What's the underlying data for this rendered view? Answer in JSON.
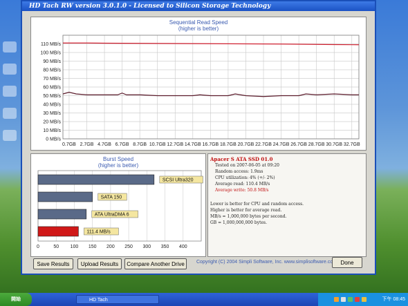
{
  "window": {
    "title": "HD Tach RW version 3.0.1.0 - Licensed to Silicon Storage Technology"
  },
  "read_chart": {
    "title": "Sequential Read Speed",
    "subtitle": "(higher is better)"
  },
  "burst_chart": {
    "title": "Burst Speed",
    "subtitle": "(higher is better)"
  },
  "results": {
    "drive_name": "Apacer S ATA SSD 01.0",
    "lines": [
      "Tested on 2007-06-05 at 09:20",
      "Random access: 1.9ms",
      "CPU utilization: 4% (+/- 2%)",
      "Average read: 110.4 MB/s",
      "Average write: 50.8 MB/s"
    ],
    "notes": [
      "Lower is better for CPU and random access.",
      "Higher is better for average read.",
      "MB/s = 1,000,000 bytes per second.",
      "GB = 1,000,000,000 bytes."
    ]
  },
  "buttons": {
    "save": "Save Results",
    "upload": "Upload Results",
    "compare": "Compare Another Drive",
    "done": "Done"
  },
  "copyright": "Copyright (C) 2004 Simpli Software, Inc. www.simplisoftware.com",
  "taskbar": {
    "start": "開始",
    "app": "HD Tach",
    "clock": "下午 08:45"
  },
  "colors": {
    "read_line": "#d02030",
    "write_line": "#5a1a2a",
    "burst_bar": "#5a6a88",
    "burst_bar_highlight": "#d01818",
    "label_box": "#f4e6a0"
  },
  "chart_data": [
    {
      "type": "line",
      "title": "Sequential Read Speed",
      "subtitle": "(higher is better)",
      "ylim": [
        0,
        120
      ],
      "y_ticks": [
        "0 MB/s",
        "10 MB/s",
        "20 MB/s",
        "30 MB/s",
        "40 MB/s",
        "50 MB/s",
        "60 MB/s",
        "70 MB/s",
        "80 MB/s",
        "90 MB/s",
        "100 MB/s",
        "110 MB/s"
      ],
      "x_ticks": [
        "0.7GB",
        "2.7GB",
        "4.7GB",
        "6.7GB",
        "8.7GB",
        "10.7GB",
        "12.7GB",
        "14.7GB",
        "16.7GB",
        "18.7GB",
        "20.7GB",
        "22.7GB",
        "24.7GB",
        "26.7GB",
        "28.7GB",
        "30.7GB",
        "32.7GB"
      ],
      "grid": true,
      "series": [
        {
          "color": "#d02030",
          "x": [
            0,
            2.7,
            4.7,
            6.7,
            8.7,
            10.7,
            12.7,
            14.7,
            16.7,
            18.7,
            20.7,
            22.7,
            24.7,
            26.7,
            28.7,
            30.7,
            33.5
          ],
          "y": [
            111,
            111,
            110.8,
            110.7,
            110.6,
            110.5,
            110.4,
            110.3,
            110.2,
            110.1,
            110,
            109.9,
            109.8,
            109.6,
            109.4,
            109.2,
            109
          ]
        },
        {
          "color": "#5a1a2a",
          "x": [
            0,
            0.7,
            1.5,
            2.7,
            4.7,
            6.2,
            6.7,
            7.2,
            8.7,
            10.7,
            12.7,
            14.7,
            15.5,
            16.7,
            18.7,
            19.5,
            20.7,
            22.7,
            24.7,
            26.7,
            27.5,
            28.7,
            30.7,
            32.7,
            33.5
          ],
          "y": [
            52,
            54,
            52,
            51,
            51,
            51,
            53,
            51,
            51,
            50,
            50,
            50,
            51,
            50,
            50,
            52,
            50,
            49,
            50,
            50,
            52,
            51,
            52,
            51,
            51
          ]
        }
      ]
    },
    {
      "type": "bar",
      "title": "Burst Speed",
      "subtitle": "(higher is better)",
      "orientation": "horizontal",
      "xlim": [
        0,
        450
      ],
      "x_ticks": [
        0,
        50,
        100,
        150,
        200,
        250,
        300,
        350,
        400
      ],
      "categories": [
        "SCSI Ultra320",
        "SATA 150",
        "ATA UltraDMA 6",
        "111.4 MB/s"
      ],
      "values": [
        320,
        150,
        133,
        111.4
      ]
    }
  ]
}
